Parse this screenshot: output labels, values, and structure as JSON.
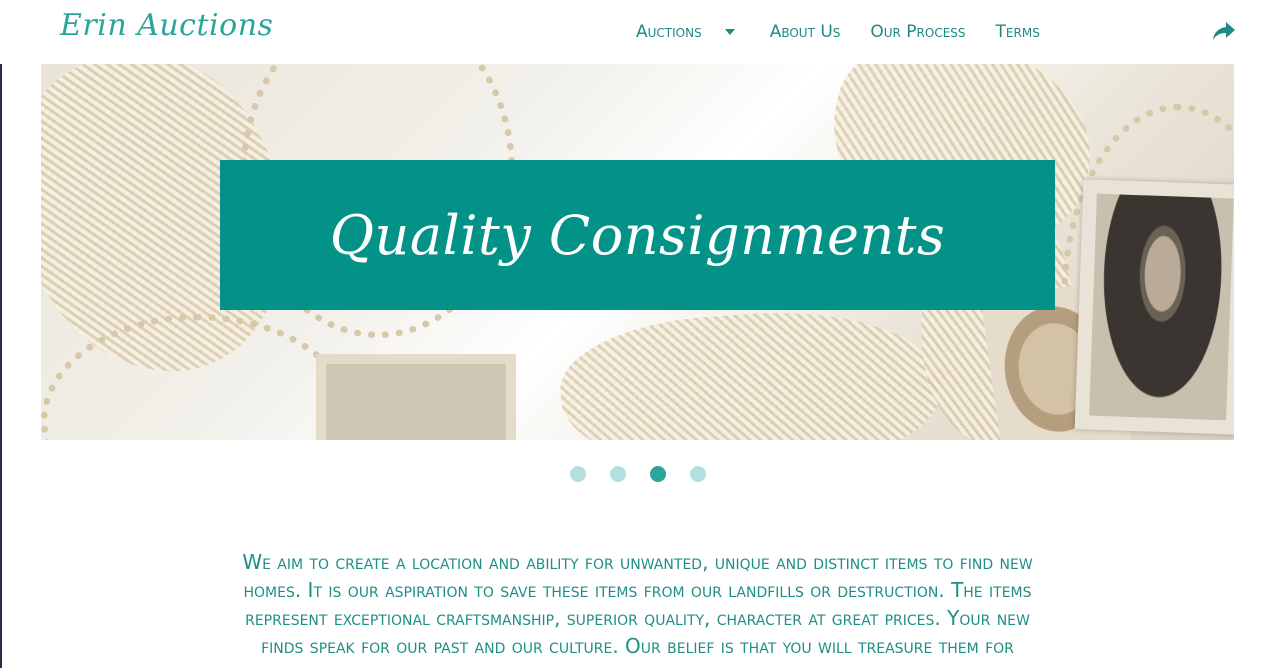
{
  "header": {
    "logo": "Erin Auctions",
    "nav": [
      {
        "label": "Auctions",
        "has_dropdown": true
      },
      {
        "label": "About Us"
      },
      {
        "label": "Our Process"
      },
      {
        "label": "Terms"
      }
    ],
    "share_icon": "share-arrow-icon"
  },
  "slider": {
    "title": "Quality Consignments",
    "slides_total": 4,
    "active_slide": 3
  },
  "main": {
    "intro": "We aim to create a location and ability for unwanted, unique and distinct items to find new homes. It is our aspiration to save these items from our landfills or destruction. The items represent exceptional craftsmanship, superior quality, character at great prices. Your new finds speak for our past and our culture. Our belief is that you will treasure them for"
  },
  "colors": {
    "accent": "#029287",
    "text": "#1f8f86",
    "dot_inactive": "#b3e0dc",
    "dot_active": "#2aa59a"
  }
}
